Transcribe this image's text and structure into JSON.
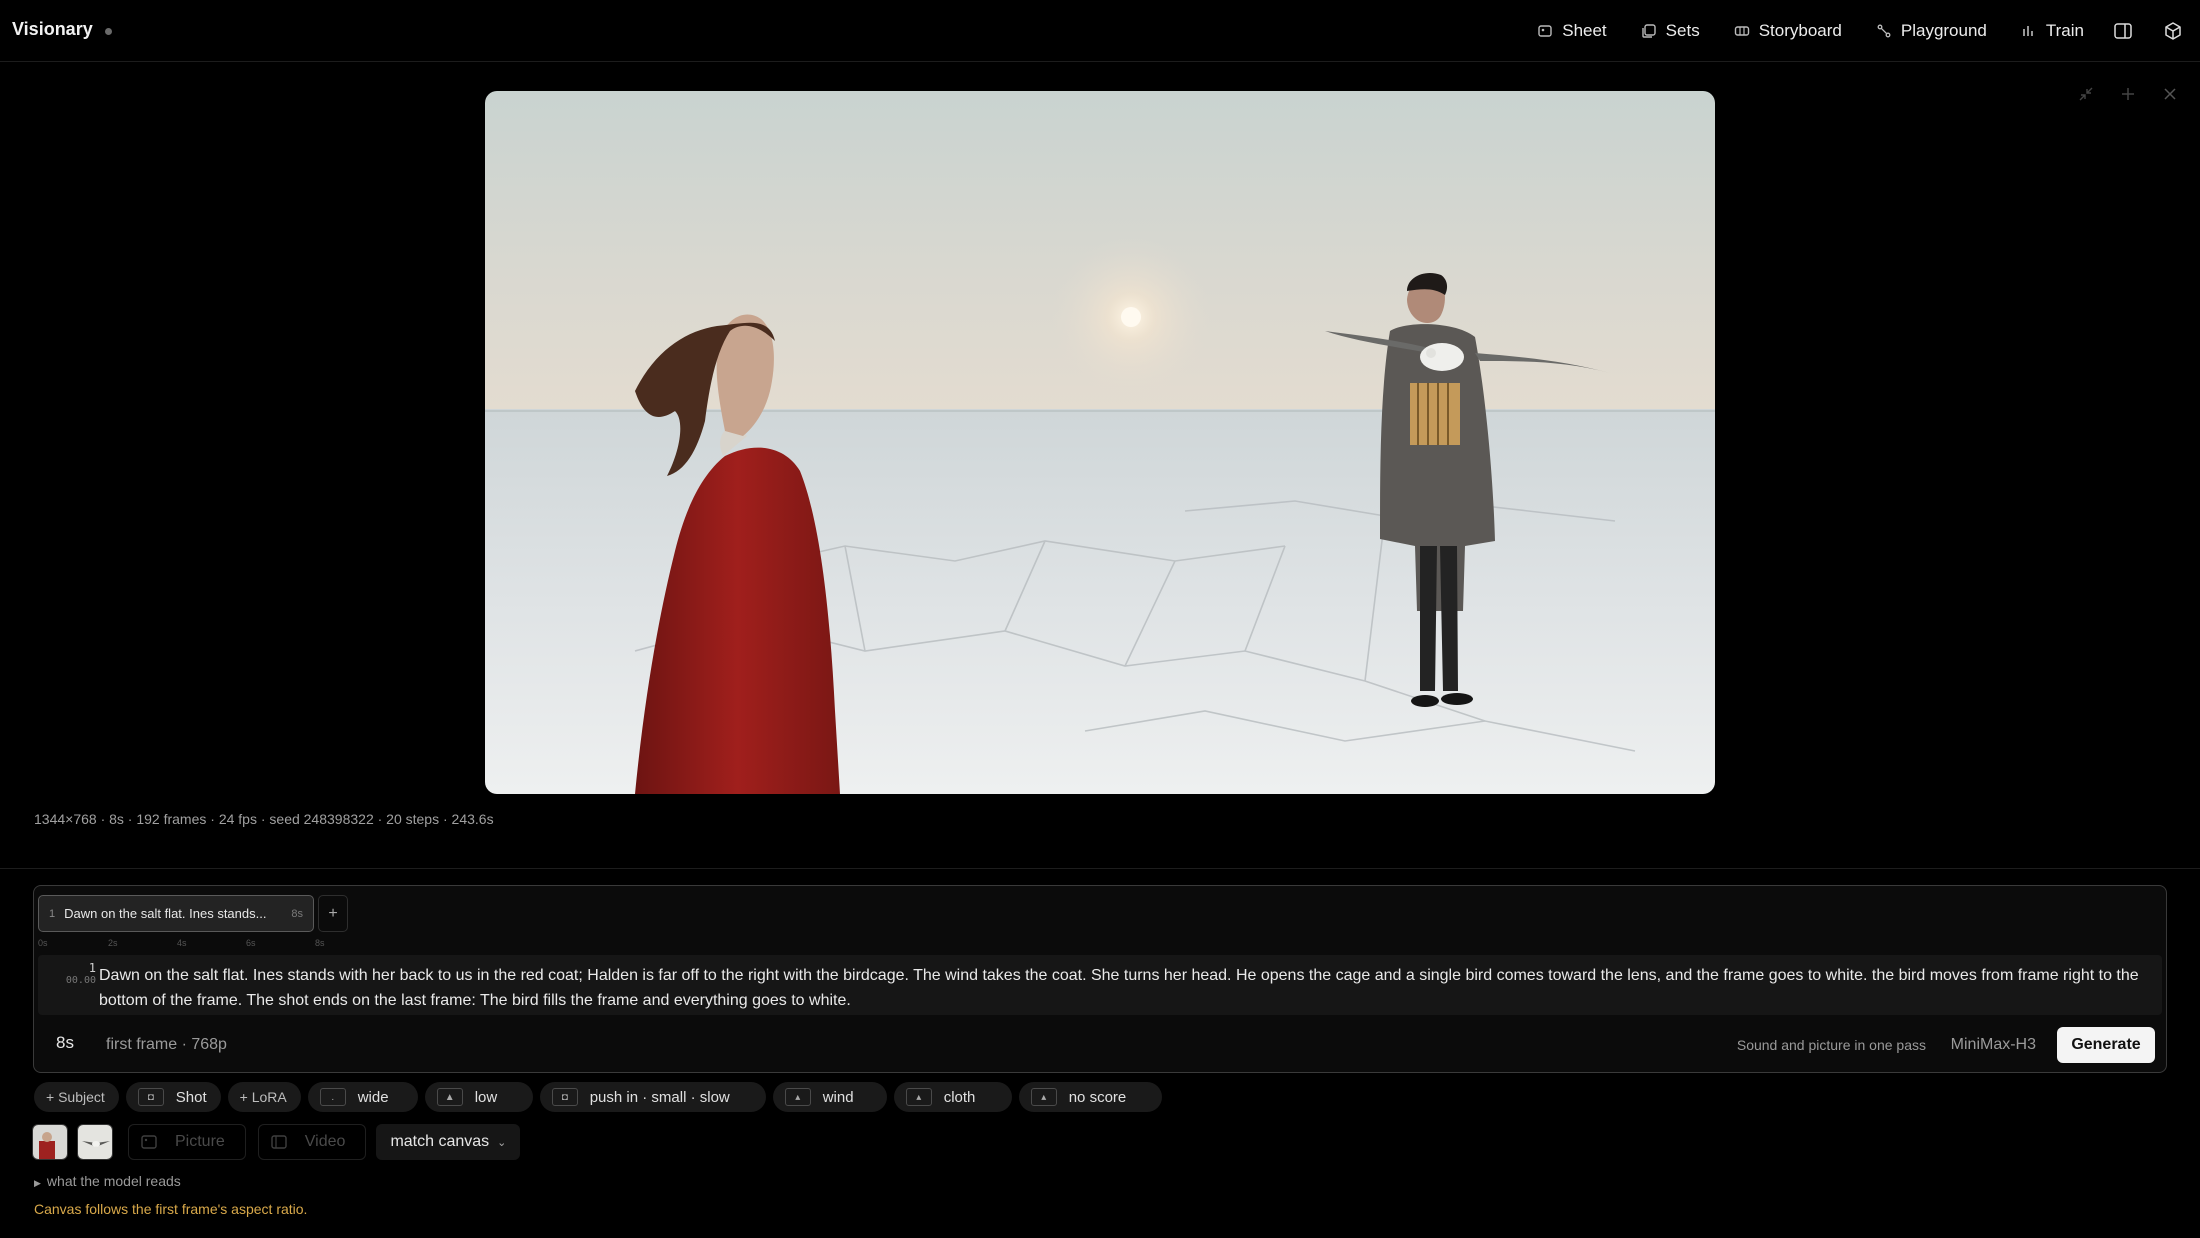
{
  "app": {
    "title": "Visionary"
  },
  "nav": {
    "items": [
      {
        "label": "Sheet",
        "icon": "image-icon"
      },
      {
        "label": "Sets",
        "icon": "copy-icon"
      },
      {
        "label": "Storyboard",
        "icon": "frames-icon"
      },
      {
        "label": "Playground",
        "icon": "branch-icon"
      },
      {
        "label": "Train",
        "icon": "bars-icon"
      }
    ]
  },
  "stage": {
    "meta": "1344×768 · 8s · 192 frames · 24 fps · seed 248398322 · 20 steps · 243.6s"
  },
  "editor": {
    "clip": {
      "index": "1",
      "title": "Dawn on the salt flat. Ines stands...",
      "duration": "8s"
    },
    "add_clip": "+",
    "ruler": [
      "0s",
      "2s",
      "4s",
      "6s",
      "8s"
    ],
    "line_number": "1",
    "timecode": "00.00",
    "prompt": "Dawn on the salt flat. Ines stands with her back to us in the red coat; Halden is far off to the right with the birdcage. The wind takes the coat. She turns her head. He opens the cage and a single bird comes toward the lens, and the frame goes to white. the bird moves from frame right to the bottom of the frame. The shot ends on the last frame: The bird fills the frame and everything goes to white.",
    "duration": "8s",
    "first_frame": "first frame · 768p",
    "sound_note": "Sound and picture in one pass",
    "model": "MiniMax-H3",
    "generate_label": "Generate"
  },
  "chips": {
    "subject": "+ Subject",
    "shot": "Shot",
    "lora": "+ LoRA",
    "framing": "wide",
    "angle": "low",
    "camera": "push in · small · slow",
    "ambience": "wind",
    "foley": "cloth",
    "score": "no score"
  },
  "refs": {
    "picture_label": "Picture",
    "video_label": "Video",
    "aspect_label": "match canvas"
  },
  "footer": {
    "model_reads": "what the model reads",
    "canvas_note": "Canvas follows the first frame's aspect ratio."
  },
  "colors": {
    "accent_warning": "#d9a94a",
    "generate_bg": "#f4f4f4",
    "coat_red": "#a01f1c"
  }
}
